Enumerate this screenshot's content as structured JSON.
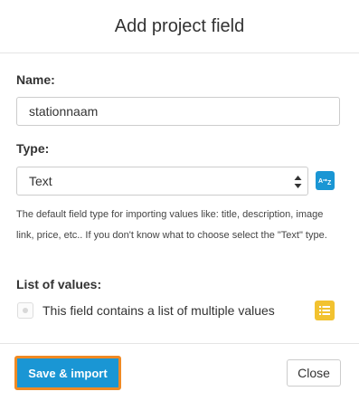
{
  "dialog": {
    "title": "Add project field"
  },
  "form": {
    "name_label": "Name:",
    "name_value": "stationnaam",
    "type_label": "Type:",
    "type_selected": "Text",
    "type_icon": "az-sort-icon",
    "help_text": "The default field type for importing values like: title, description, image link, price, etc.. If you don't know what to choose select the \"Text\" type.",
    "list_label": "List of values:",
    "list_checkbox_label": "This field contains a list of multiple values",
    "list_checked": false,
    "list_icon": "list-icon"
  },
  "footer": {
    "save_label": "Save & import",
    "close_label": "Close"
  },
  "colors": {
    "primary": "#1a96d4",
    "focus_outline": "#f08a24",
    "list_icon_bg": "#f2c230"
  }
}
